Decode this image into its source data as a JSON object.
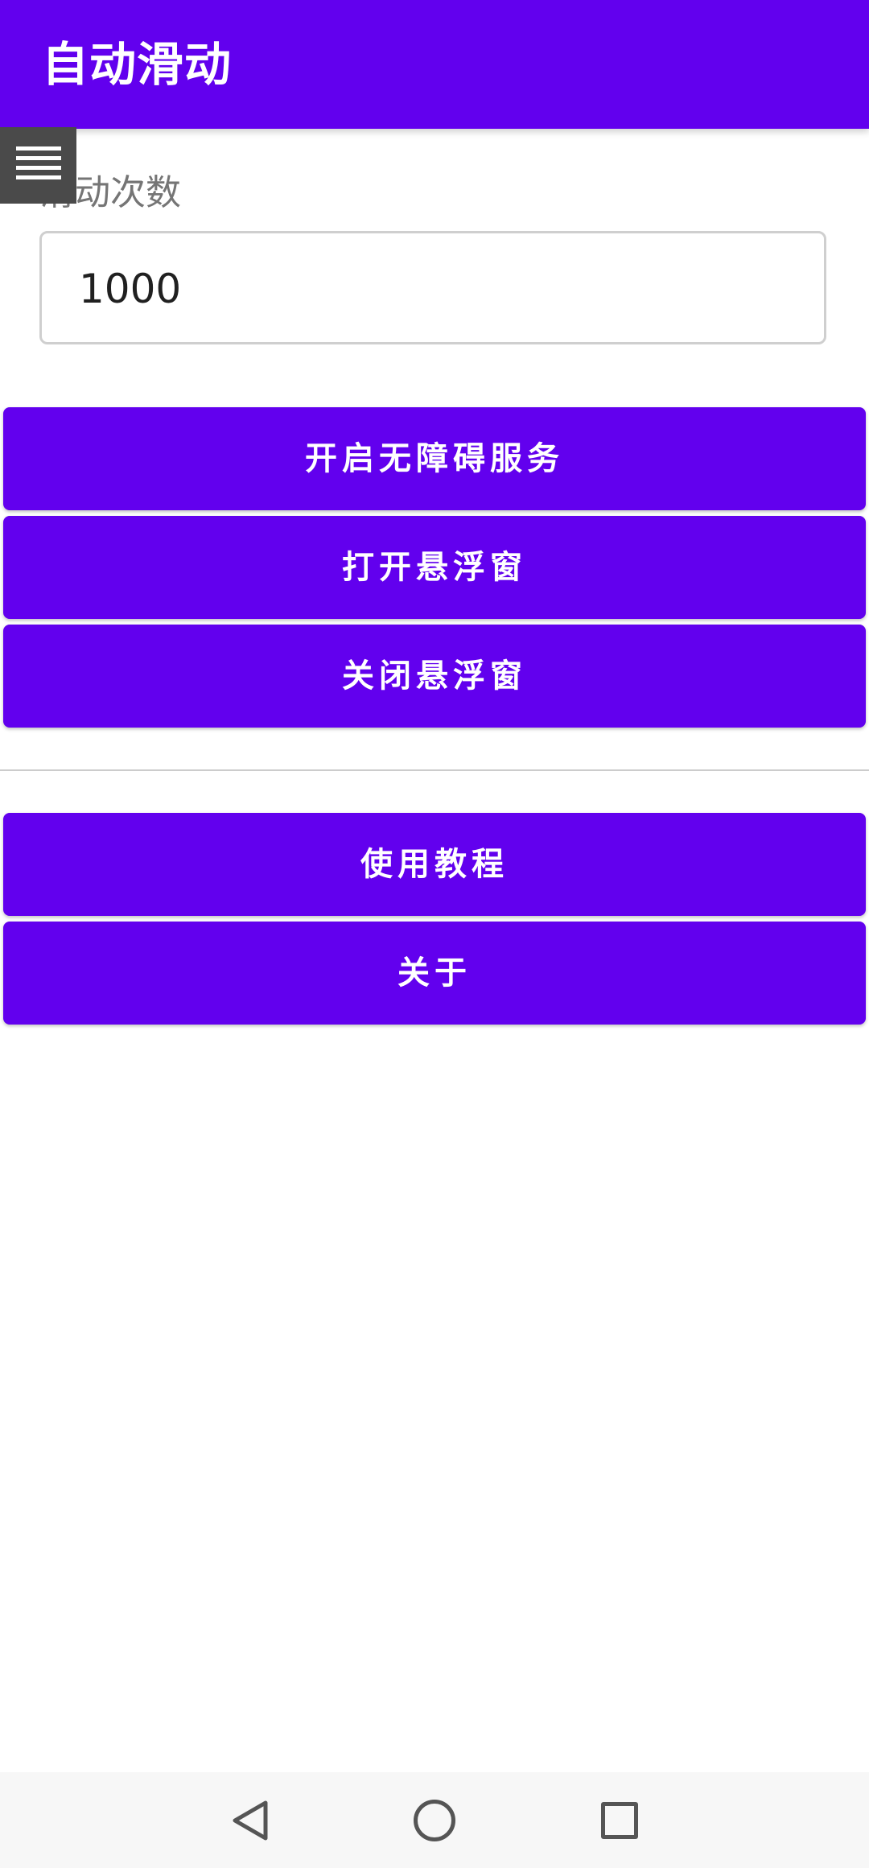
{
  "app_bar": {
    "title": "自动滑动"
  },
  "menu": {
    "icon": "hamburger-menu-icon"
  },
  "swipe_count": {
    "label": "滑动次数",
    "value": "1000"
  },
  "buttons": {
    "enable_accessibility": "开启无障碍服务",
    "open_floating_window": "打开悬浮窗",
    "close_floating_window": "关闭悬浮窗",
    "tutorial": "使用教程",
    "about": "关于"
  },
  "navigation": {
    "back_icon": "back-triangle-icon",
    "home_icon": "home-circle-icon",
    "recents_icon": "recents-square-icon"
  },
  "colors": {
    "primary": "#6200EE",
    "on_primary": "#FFFFFF"
  }
}
